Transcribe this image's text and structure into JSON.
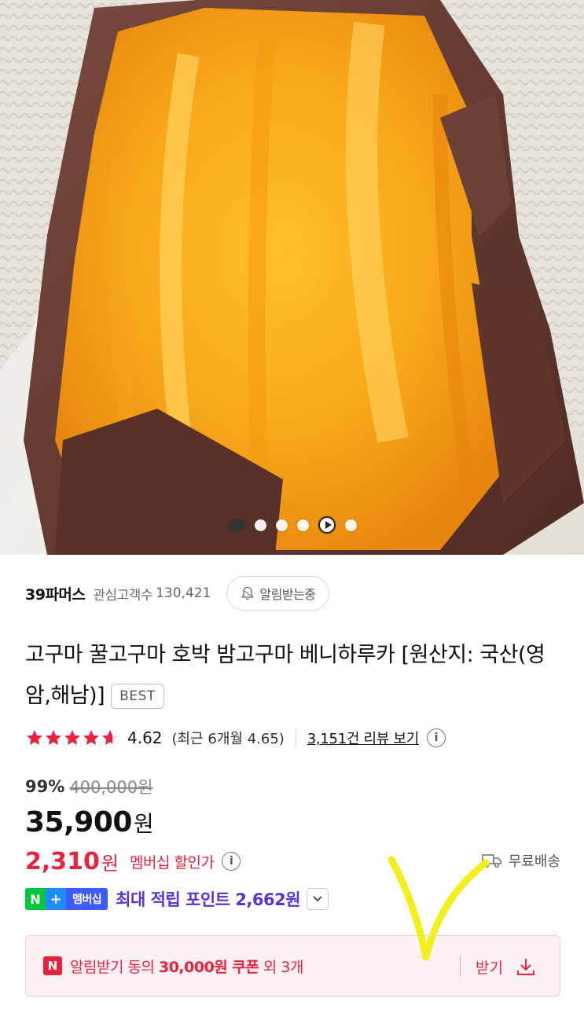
{
  "gallery": {
    "image_alt": "고구마",
    "page_dots": [
      "active",
      "dot",
      "dot",
      "dot",
      "play",
      "dot"
    ]
  },
  "seller": {
    "name": "39파머스",
    "fans_label": "관심고객수",
    "fans_count": "130,421",
    "alarm_button": "알림받는중"
  },
  "product": {
    "title": "고구마 꿀고구마 호박 밤고구마 베니하루카 [원산지: 국산(영암,해남)]",
    "badge": "BEST"
  },
  "rating": {
    "stars": 4.62,
    "score": "4.62",
    "recent": "(최근 6개월 4.65)",
    "review_link": "3,151건 리뷰 보기"
  },
  "pricing": {
    "discount_rate": "99%",
    "original_price": "400,000원",
    "price": "35,900",
    "price_unit": "원",
    "member_price": "2,310",
    "member_unit": "원",
    "member_label": "멤버십 할인가",
    "shipping": "무료배송"
  },
  "points": {
    "badge_n": "N",
    "badge_plus": "+",
    "badge_text": "멤버십",
    "text": "최대 적립 포인트 2,662원"
  },
  "coupon": {
    "badge": "N",
    "text_prefix": "알림받기 동의 ",
    "text_bold": "30,000원 쿠폰",
    "text_suffix": " 외 3개",
    "get_label": "받기"
  },
  "colors": {
    "accent_red": "#e8233d",
    "points_purple": "#5b32d6",
    "star_red": "#e8233d",
    "annotation_yellow": "#f2ef1f"
  }
}
